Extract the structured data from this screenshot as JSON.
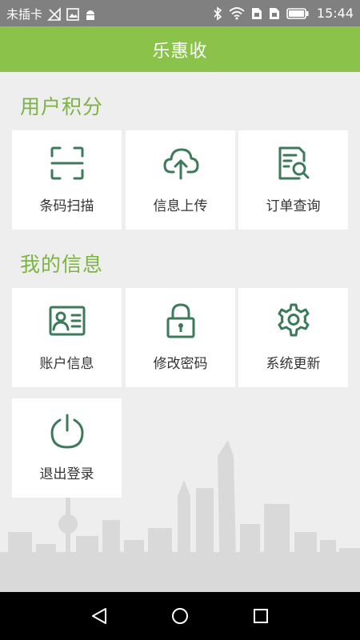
{
  "status_bar": {
    "carrier": "未插卡",
    "time": "15:44"
  },
  "app_bar": {
    "title": "乐惠收"
  },
  "sections": [
    {
      "title": "用户积分",
      "items": [
        {
          "label": "条码扫描",
          "icon": "scan-icon"
        },
        {
          "label": "信息上传",
          "icon": "cloud-upload-icon"
        },
        {
          "label": "订单查询",
          "icon": "order-search-icon"
        }
      ]
    },
    {
      "title": "我的信息",
      "items": [
        {
          "label": "账户信息",
          "icon": "id-card-icon"
        },
        {
          "label": "修改密码",
          "icon": "lock-icon"
        },
        {
          "label": "系统更新",
          "icon": "gear-icon"
        },
        {
          "label": "退出登录",
          "icon": "power-icon"
        }
      ]
    }
  ],
  "colors": {
    "accent": "#8bc34a",
    "section_title": "#7cb342",
    "icon": "#3d7a5a"
  }
}
